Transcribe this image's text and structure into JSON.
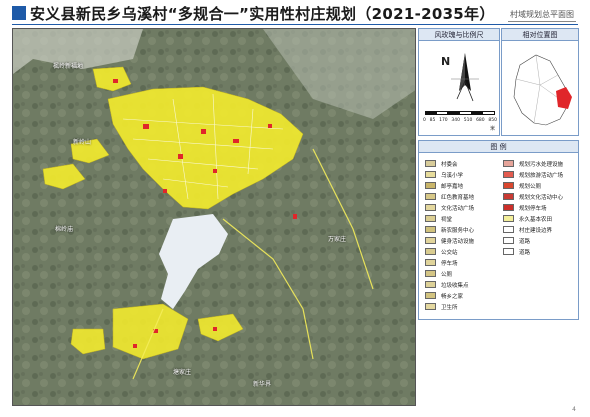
{
  "header": {
    "title": "安义县新民乡乌溪村“多规合一”实用性村庄规划（2021-2035年）",
    "subtitle": "村域规划总平面图"
  },
  "map": {
    "place_labels": [
      "楓岭新福地",
      "新岭山",
      "棉岭庙",
      "万家庄",
      "塘家庄",
      "新华界"
    ]
  },
  "compass_panel": {
    "header": "风玫瑰与比例尺",
    "north_label": "N",
    "scale_ticks": [
      "0",
      "85",
      "170",
      "340",
      "510",
      "680",
      "850"
    ],
    "scale_unit": "米"
  },
  "locator_panel": {
    "header": "相对位置图"
  },
  "legend": {
    "header": "图  例",
    "left_items": [
      {
        "label": "村委会",
        "color": "#d8cc9a"
      },
      {
        "label": "乌溪小学",
        "color": "#e7dc9c"
      },
      {
        "label": "邮亭嘉地",
        "color": "#c9b56a"
      },
      {
        "label": "红色教育基地",
        "color": "#d7c888"
      },
      {
        "label": "文化活动广场",
        "color": "#e3d79e"
      },
      {
        "label": "祠堂",
        "color": "#dccf93"
      },
      {
        "label": "新农服务中心",
        "color": "#d1c27d"
      },
      {
        "label": "健身活动设施",
        "color": "#e2d59c"
      },
      {
        "label": "公交站",
        "color": "#d9cc90"
      },
      {
        "label": "停车场",
        "color": "#e0d49b"
      },
      {
        "label": "公厕",
        "color": "#d4c585"
      },
      {
        "label": "垃圾收集点",
        "color": "#ddd198"
      },
      {
        "label": "畅乡之家",
        "color": "#d2c380"
      },
      {
        "label": "卫生所",
        "color": "#e4d8a0"
      }
    ],
    "right_items": [
      {
        "label": "规划污水处理设施",
        "color": "#e6a49a"
      },
      {
        "label": "规划旅游活动广场",
        "color": "#e35b4f"
      },
      {
        "label": "规划公厕",
        "color": "#d9472f"
      },
      {
        "label": "规划文化活动中心",
        "color": "#c93a33"
      },
      {
        "label": "规划停车场",
        "color": "#cc2f2a"
      },
      {
        "label": "永久基本农田",
        "color": "#f3ef9a"
      },
      {
        "label": "村庄建设边界",
        "color": "#ffffff"
      },
      {
        "label": "道路",
        "color": "#ffffff"
      },
      {
        "label": "道路",
        "color": "#ffffff"
      }
    ]
  },
  "page_number": "4",
  "colors": {
    "title_accent": "#1e5aa8",
    "village_fill": "#f2ea2e",
    "highlight_red": "#e0262a",
    "water": "#e9eef3"
  }
}
